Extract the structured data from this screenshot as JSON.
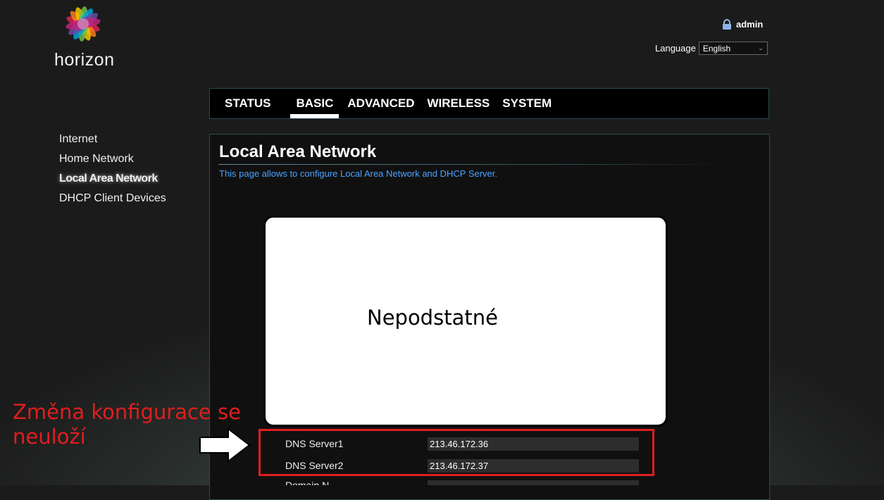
{
  "brand": {
    "name": "horizon"
  },
  "header": {
    "user": "admin",
    "language_label": "Language",
    "language_value": "English"
  },
  "nav": {
    "tabs": [
      "STATUS",
      "BASIC",
      "ADVANCED",
      "WIRELESS",
      "SYSTEM"
    ],
    "active": "BASIC"
  },
  "sidebar": {
    "items": [
      "Internet",
      "Home Network",
      "Local Area Network",
      "DHCP Client Devices"
    ],
    "active": "Local Area Network"
  },
  "main": {
    "title": "Local Area Network",
    "description": "This page allows to configure Local Area Network and DHCP Server.",
    "dns1_label": "DNS Server1",
    "dns1_value": "213.46.172.36",
    "dns2_label": "DNS Server2",
    "dns2_value": "213.46.172.37",
    "partial_label": "Domain N"
  },
  "overlay": {
    "text": "Nepodstatné"
  },
  "annotation": {
    "line1": "Změna konfigurace se",
    "line2": "neuloží"
  },
  "colors": {
    "accent_link": "#4aa3ff",
    "annotation_red": "#e01e1e",
    "panel_border": "#2f4a52"
  },
  "icons": {
    "user": "lock-icon",
    "language_dropdown": "chevron-down-icon",
    "pointer": "arrow-right-icon"
  }
}
